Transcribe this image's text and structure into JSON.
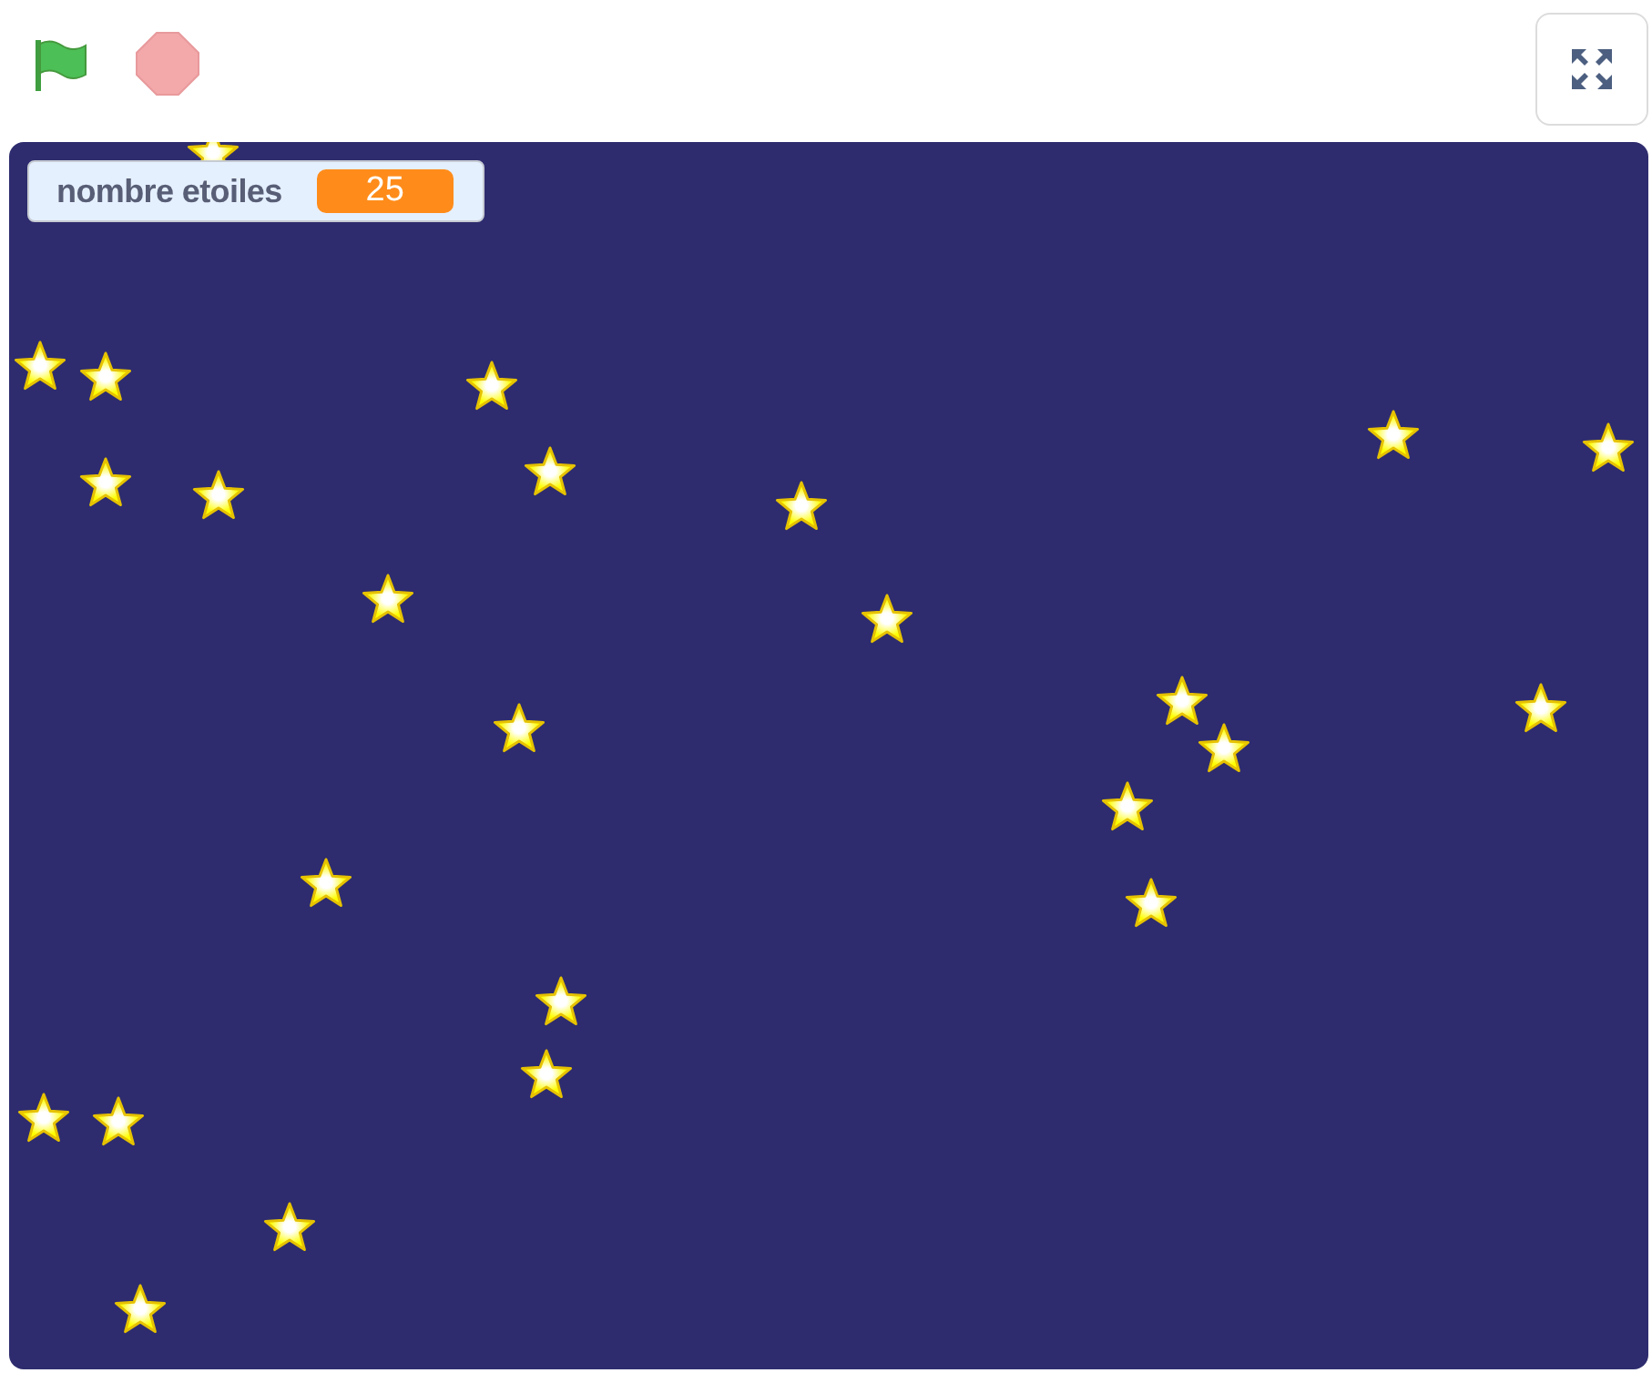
{
  "toolbar": {
    "green_flag": {
      "kind": "flag"
    },
    "stop": {
      "kind": "stop"
    },
    "fullscreen": {
      "kind": "fullscreen"
    }
  },
  "stage": {
    "monitor": {
      "label": "nombre etoiles",
      "value": "25"
    }
  }
}
